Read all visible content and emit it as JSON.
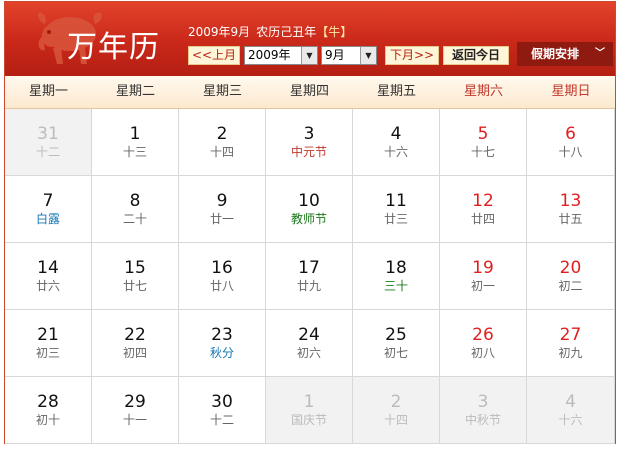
{
  "header": {
    "title": "万年历",
    "subtitle": {
      "date": "2009年9月",
      "lunar_year": "农历己丑年",
      "zodiac": "【牛】"
    },
    "prev_month": "<<上月",
    "year_select": "2009年",
    "month_select": "9月",
    "next_month": "下月>>",
    "today": "返回今日",
    "holiday_menu": "假期安排"
  },
  "weekdays": [
    "星期一",
    "星期二",
    "星期三",
    "星期四",
    "星期五",
    "星期六",
    "星期日"
  ],
  "weeks": [
    [
      {
        "day": "31",
        "lunar": "十二",
        "other": true
      },
      {
        "day": "1",
        "lunar": "十三"
      },
      {
        "day": "2",
        "lunar": "十四"
      },
      {
        "day": "3",
        "lunar": "中元节",
        "type": "festival"
      },
      {
        "day": "4",
        "lunar": "十六"
      },
      {
        "day": "5",
        "lunar": "十七"
      },
      {
        "day": "6",
        "lunar": "十八"
      }
    ],
    [
      {
        "day": "7",
        "lunar": "白露",
        "type": "solar-term-blue"
      },
      {
        "day": "8",
        "lunar": "二十"
      },
      {
        "day": "9",
        "lunar": "廿一"
      },
      {
        "day": "10",
        "lunar": "教师节",
        "type": "solar-term"
      },
      {
        "day": "11",
        "lunar": "廿三"
      },
      {
        "day": "12",
        "lunar": "廿四"
      },
      {
        "day": "13",
        "lunar": "廿五"
      }
    ],
    [
      {
        "day": "14",
        "lunar": "廿六"
      },
      {
        "day": "15",
        "lunar": "廿七"
      },
      {
        "day": "16",
        "lunar": "廿八"
      },
      {
        "day": "17",
        "lunar": "廿九"
      },
      {
        "day": "18",
        "lunar": "三十",
        "type": "solar-term"
      },
      {
        "day": "19",
        "lunar": "初一"
      },
      {
        "day": "20",
        "lunar": "初二"
      }
    ],
    [
      {
        "day": "21",
        "lunar": "初三"
      },
      {
        "day": "22",
        "lunar": "初四"
      },
      {
        "day": "23",
        "lunar": "秋分",
        "type": "solar-term-blue"
      },
      {
        "day": "24",
        "lunar": "初六"
      },
      {
        "day": "25",
        "lunar": "初七"
      },
      {
        "day": "26",
        "lunar": "初八"
      },
      {
        "day": "27",
        "lunar": "初九"
      }
    ],
    [
      {
        "day": "28",
        "lunar": "初十"
      },
      {
        "day": "29",
        "lunar": "十一"
      },
      {
        "day": "30",
        "lunar": "十二"
      },
      {
        "day": "1",
        "lunar": "国庆节",
        "type": "festival",
        "other": true
      },
      {
        "day": "2",
        "lunar": "十四",
        "other": true
      },
      {
        "day": "3",
        "lunar": "中秋节",
        "type": "festival",
        "other": true
      },
      {
        "day": "4",
        "lunar": "十六",
        "other": true
      }
    ]
  ]
}
